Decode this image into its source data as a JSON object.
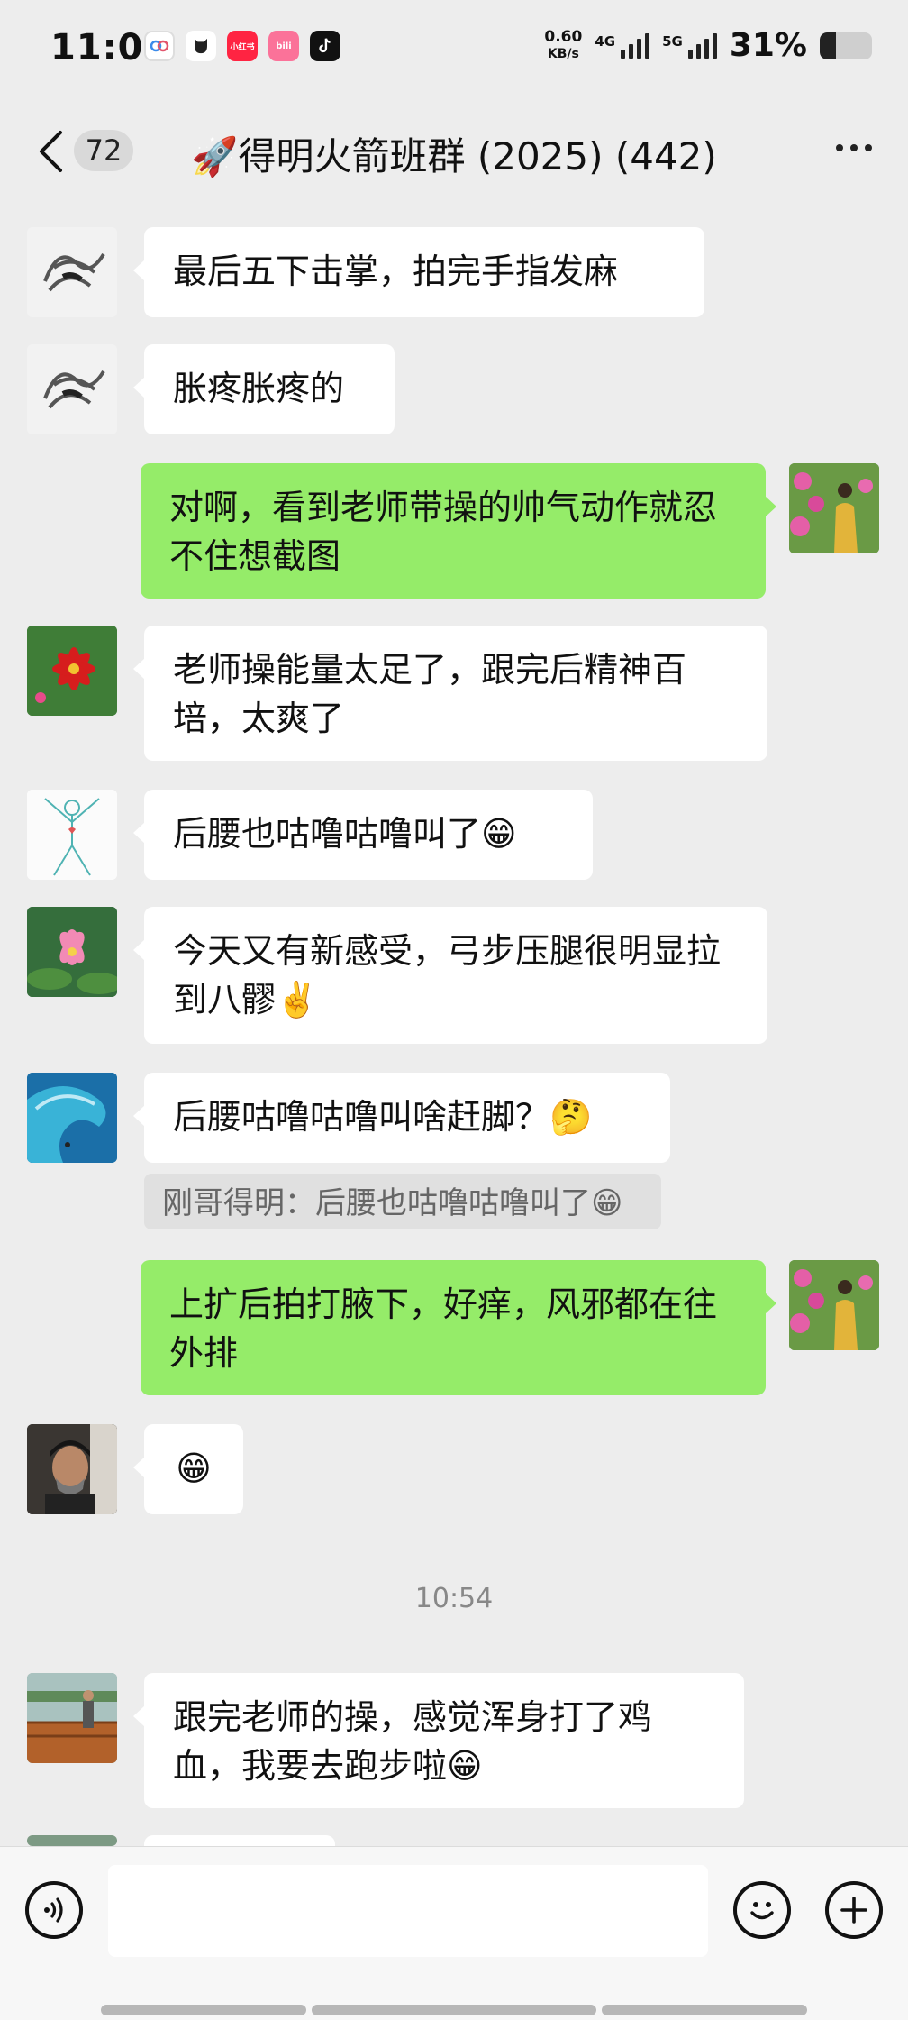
{
  "status_bar": {
    "time": "11:01",
    "net_speed_value": "0.60",
    "net_speed_unit": "KB/s",
    "signal1_label": "4G",
    "signal2_label": "5G",
    "battery_percent": "31%",
    "battery_level": 0.31
  },
  "nav": {
    "unread_count": "72",
    "title": "🚀得明火箭班群 (2025) (442)"
  },
  "messages": [
    {
      "side": "left",
      "text": "最后五下击掌，拍完手指发麻",
      "avatar": "sketch-avatar"
    },
    {
      "side": "left",
      "text": "胀疼胀疼的",
      "avatar": "sketch-avatar"
    },
    {
      "side": "right",
      "text": "对啊，看到老师带操的帅气动作就忍不住想截图",
      "avatar": "flower-woman-avatar"
    },
    {
      "side": "left",
      "text": "老师操能量太足了，跟完后精神百培，太爽了",
      "avatar": "red-flower-avatar"
    },
    {
      "side": "left",
      "text": "后腰也咕噜咕噜叫了😁",
      "avatar": "line-figure-avatar"
    },
    {
      "side": "left",
      "text": "今天又有新感受，弓步压腿很明显拉到八髎✌️",
      "avatar": "lotus-avatar"
    },
    {
      "side": "left",
      "text": "后腰咕噜咕噜叫啥赶脚？🤔",
      "avatar": "wave-avatar",
      "quote": "刚哥得明：后腰也咕噜咕噜叫了😁"
    },
    {
      "side": "right",
      "text": "上扩后拍打腋下，好痒，风邪都在往外排",
      "avatar": "flower-woman-avatar"
    },
    {
      "side": "left",
      "text": "😁",
      "avatar": "man-avatar"
    },
    {
      "side": "left",
      "text": "跟完老师的操，感觉浑身打了鸡血，我要去跑步啦😁",
      "avatar": "outdoor-avatar"
    }
  ],
  "time_separator": "10:54",
  "input": {
    "placeholder": ""
  },
  "colors": {
    "background": "#ededed",
    "self_bubble": "#95ec69",
    "other_bubble": "#ffffff"
  }
}
